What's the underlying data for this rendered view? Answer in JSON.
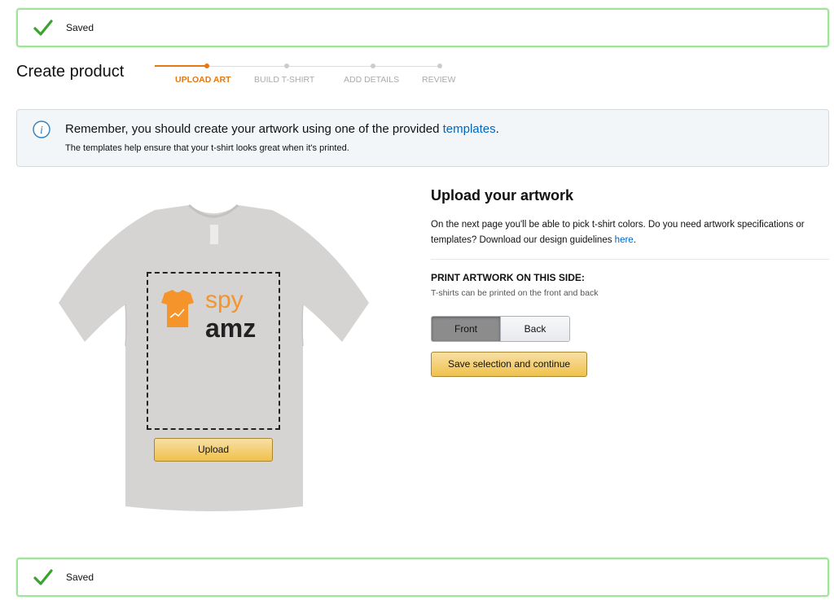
{
  "alerts": {
    "top": {
      "text": "Saved",
      "icon": "check-icon",
      "color": "#3aa22e"
    },
    "bottom": {
      "text": "Saved",
      "icon": "check-icon",
      "color": "#3aa22e"
    }
  },
  "header": {
    "title": "Create product",
    "steps": [
      {
        "label": "UPLOAD ART",
        "active": true
      },
      {
        "label": "BUILD T-SHIRT",
        "active": false
      },
      {
        "label": "ADD DETAILS",
        "active": false
      },
      {
        "label": "REVIEW",
        "active": false
      }
    ],
    "accent": "#e47911"
  },
  "info": {
    "icon": "info-icon",
    "main_prefix": "Remember, you should create your artwork using one of the provided ",
    "main_link": "templates",
    "main_suffix": ".",
    "sub": "The templates help ensure that your t-shirt looks great when it's printed."
  },
  "preview": {
    "logo_top": "spy",
    "logo_bottom": "amz",
    "upload_label": "Upload"
  },
  "panel": {
    "title": "Upload your artwork",
    "desc_prefix": "On the next page you'll be able to pick t-shirt colors. Do you need artwork specifications or templates? Download our design guidelines ",
    "desc_link": "here",
    "desc_suffix": ".",
    "section_title": "PRINT ARTWORK ON THIS SIDE:",
    "section_sub": "T-shirts can be printed on the front and back",
    "sides": [
      {
        "label": "Front",
        "selected": true
      },
      {
        "label": "Back",
        "selected": false
      }
    ],
    "save_label": "Save selection and continue"
  }
}
